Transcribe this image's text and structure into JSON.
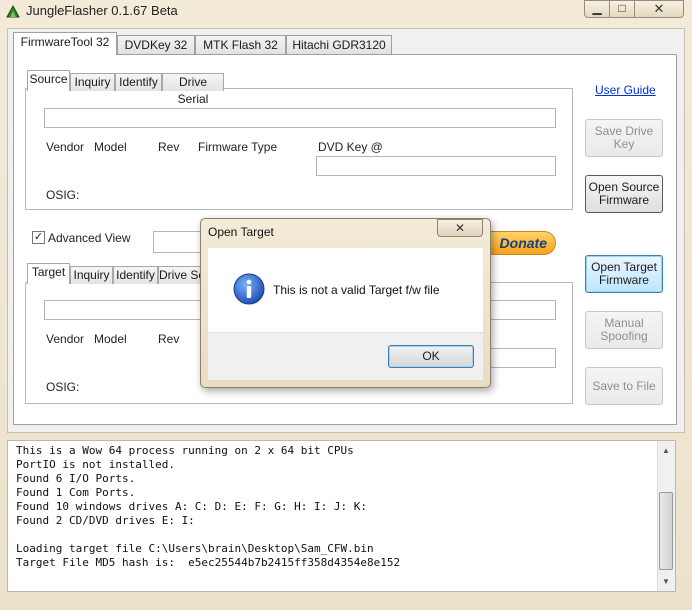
{
  "window": {
    "title": "JungleFlasher 0.1.67 Beta",
    "min_glyph": "▁",
    "max_glyph": "□",
    "close_glyph": "✕"
  },
  "tabs": [
    "FirmwareTool 32",
    "DVDKey 32",
    "MTK Flash 32",
    "Hitachi GDR3120"
  ],
  "source": {
    "tabs": [
      "Source",
      "Inquiry",
      "Identify",
      "Drive Serial"
    ],
    "vendor_label": "Vendor",
    "model_label": "Model",
    "rev_label": "Rev",
    "fw_type_label": "Firmware Type",
    "dvd_key_label": "DVD Key @",
    "osig_label": "OSIG:"
  },
  "target": {
    "tabs": [
      "Target",
      "Inquiry",
      "Identify",
      "Drive Se"
    ],
    "vendor_label": "Vendor",
    "model_label": "Model",
    "rev_label": "Rev",
    "osig_label": "OSIG:"
  },
  "advanced_view": {
    "label": "Advanced View",
    "checked": true,
    "mark": "✓"
  },
  "donate_label": "Donate",
  "user_guide_label": "User Guide",
  "buttons": {
    "save_drive_key": [
      "Save Drive",
      "Key"
    ],
    "open_source_fw": [
      "Open Source",
      "Firmware"
    ],
    "open_target_fw": [
      "Open Target",
      "Firmware"
    ],
    "manual_spoofing": [
      "Manual",
      "Spoofing"
    ],
    "save_to_file": "Save to File"
  },
  "log": {
    "lines": [
      "This is a Wow 64 process running on 2 x 64 bit CPUs",
      "PortIO is not installed.",
      "Found 6 I/O Ports.",
      "Found 1 Com Ports.",
      "Found 10 windows drives A: C: D: E: F: G: H: I: J: K:",
      "Found 2 CD/DVD drives E: I:",
      "",
      "Loading target file C:\\Users\\brain\\Desktop\\Sam_CFW.bin",
      "Target File MD5 hash is:  e5ec25544b7b2415ff358d4354e8e152"
    ],
    "up_arrow": "▲",
    "down_arrow": "▼"
  },
  "dialog": {
    "title": "Open Target",
    "message": "This is not a valid Target f/w file",
    "ok_label": "OK",
    "close_glyph": "✕",
    "icon_glyph": "i"
  },
  "colors": {
    "frame": "#efe6d2",
    "link": "#0033cc",
    "focus_border": "#3c7fb1",
    "info_icon": "#1f5fc7",
    "donate": "#f7a21b"
  }
}
